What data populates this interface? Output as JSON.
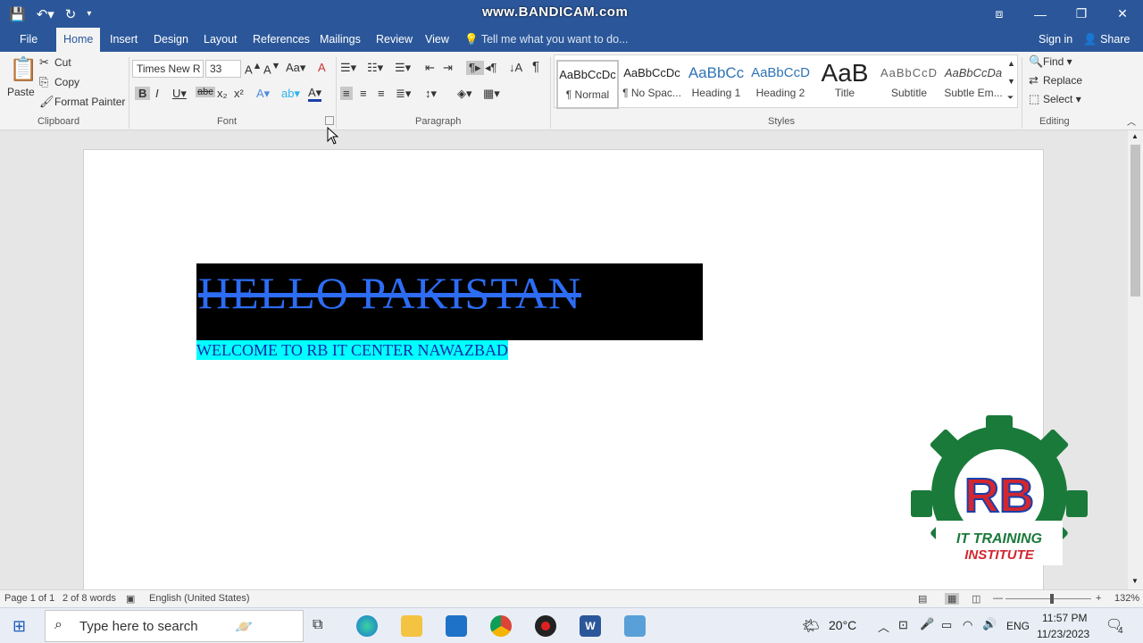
{
  "titlebar": {
    "watermark": "www.BANDICAM.com"
  },
  "tabs": [
    "File",
    "Home",
    "Insert",
    "Design",
    "Layout",
    "References",
    "Mailings",
    "Review",
    "View"
  ],
  "tellme": "Tell me what you want to do...",
  "account": {
    "signin": "Sign in",
    "share": "Share"
  },
  "clipboard": {
    "paste": "Paste",
    "cut": "Cut",
    "copy": "Copy",
    "format_painter": "Format Painter",
    "group": "Clipboard"
  },
  "font": {
    "name": "Times New R",
    "size": "33",
    "group": "Font"
  },
  "paragraph": {
    "group": "Paragraph"
  },
  "styles": {
    "group": "Styles",
    "items": [
      {
        "preview": "AaBbCcDc",
        "label": "¶ Normal"
      },
      {
        "preview": "AaBbCcDc",
        "label": "¶ No Spac..."
      },
      {
        "preview": "AaBbCc",
        "label": "Heading 1"
      },
      {
        "preview": "AaBbCcD",
        "label": "Heading 2"
      },
      {
        "preview": "AaB",
        "label": "Title"
      },
      {
        "preview": "AaBbCcD",
        "label": "Subtitle"
      },
      {
        "preview": "AaBbCcDa",
        "label": "Subtle Em..."
      }
    ]
  },
  "editing": {
    "find": "Find",
    "replace": "Replace",
    "select": "Select",
    "group": "Editing"
  },
  "document": {
    "heading": "HELLO PAKISTAN",
    "subline": "WELCOME TO RB IT CENTER NAWAZBAD"
  },
  "logo": {
    "letters": "RB",
    "line1": "IT TRAINING",
    "line2": "INSTITUTE"
  },
  "status": {
    "page": "Page 1 of 1",
    "words": "2 of 8 words",
    "language": "English (United States)",
    "zoom": "132%"
  },
  "taskbar": {
    "search_placeholder": "Type here to search",
    "temp": "20°C",
    "lang": "ENG",
    "time": "11:57 PM",
    "date": "11/23/2023",
    "notif": "4"
  },
  "colors": {
    "accent": "#2b579a",
    "heading_text": "#2d6cf5",
    "highlight": "#00ffff",
    "logo_green": "#1a7a3a",
    "logo_red": "#d22630"
  }
}
